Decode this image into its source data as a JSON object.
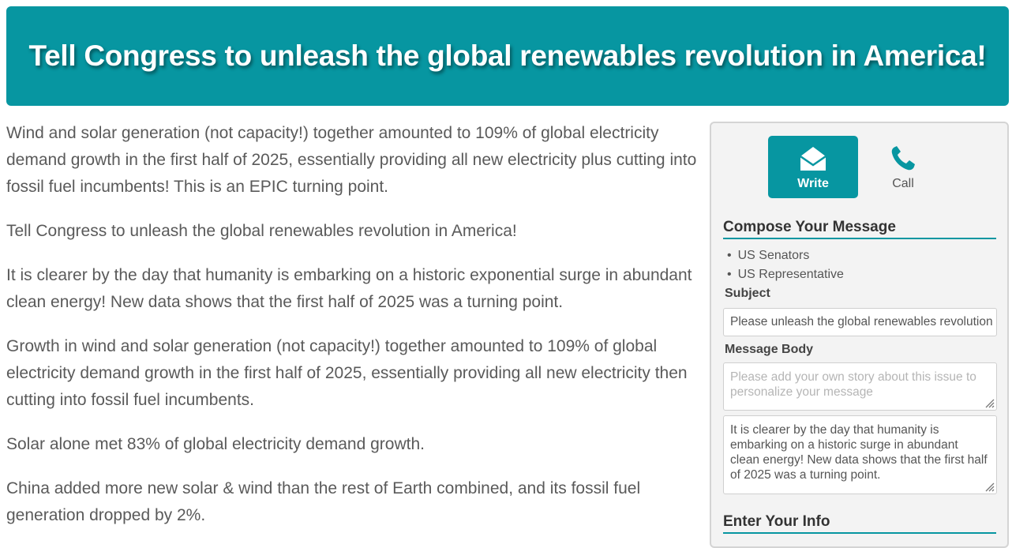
{
  "banner": {
    "title": "Tell Congress to unleash the global renewables revolution in America!"
  },
  "article": {
    "paragraphs": [
      "Wind and solar generation (not capacity!) together amounted to 109% of global electricity demand growth in the first half of 2025, essentially providing all new electricity plus cutting into fossil fuel incumbents! This is an EPIC turning point.",
      "Tell Congress to unleash the global renewables revolution in America!",
      "It is clearer by the day that humanity is embarking on a historic exponential surge in abundant clean energy! New data shows that the first half of 2025 was a turning point.",
      "Growth in wind and solar generation (not capacity!) together amounted to 109% of global electricity demand growth in the first half of 2025, essentially providing all new electricity then cutting into fossil fuel incumbents.",
      "Solar alone met 83% of global electricity demand growth.",
      "China added more new solar & wind than the rest of Earth combined, and its fossil fuel generation dropped by 2%."
    ]
  },
  "panel": {
    "tabs": [
      {
        "label": "Write",
        "icon": "envelope-icon",
        "active": true
      },
      {
        "label": "Call",
        "icon": "phone-icon",
        "active": false
      }
    ],
    "compose_title": "Compose Your Message",
    "recipients": [
      "US Senators",
      "US Representative"
    ],
    "subject_label": "Subject",
    "subject_value": "Please unleash the global renewables revolution in America",
    "body_label": "Message Body",
    "body_placeholder": "Please add your own story about this issue to personalize your message",
    "body_text": "It is clearer by the day that humanity is embarking on a historic surge in abundant clean energy! New data shows that the first half of 2025 was a turning point.",
    "info_title": "Enter Your Info"
  },
  "colors": {
    "accent": "#0796a1",
    "text": "#5a5a5a"
  }
}
